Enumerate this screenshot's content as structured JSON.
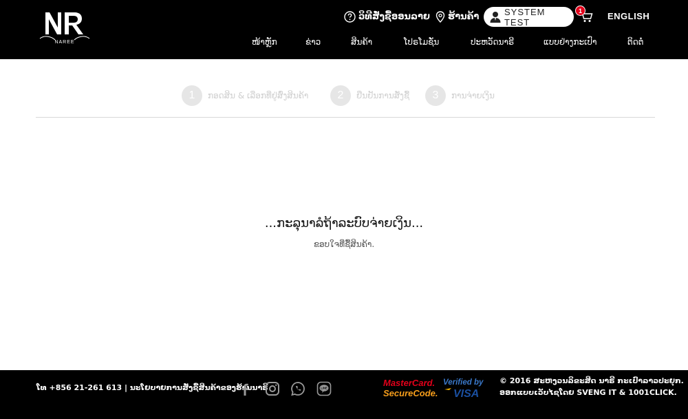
{
  "header": {
    "logo_text": "NAREE",
    "howto_label": "ວິທີສັ່ງຊື້ອອນລາຍ",
    "store_label": "ຮ້ານຄ້າ",
    "user_name": "SYSTEM TEST",
    "cart_count": "1",
    "language": "ENGLISH"
  },
  "nav": {
    "items": [
      "ໜ້າຫຼັກ",
      "ຂ່າວ",
      "ສິນຄ້າ",
      "ໂປຣໂມຊັ່ນ",
      "ປະຫວັດນາຣີ",
      "ແບບຢ່າງກະເປົາ",
      "ຕິດຕໍ່"
    ]
  },
  "steps": [
    {
      "num": "1",
      "label": "ກອດສິນ & ເລືອກທີ່ຢູ່ສົ່ງສິນຄ້າ"
    },
    {
      "num": "2",
      "label": "ຢືນຢັນການສັ່ງຊື້"
    },
    {
      "num": "3",
      "label": "ການຈ່າຍເງິນ"
    }
  ],
  "main": {
    "title": "...ກະລຸນາລໍຖ້າລະບົບຈ່າຍເງິນ...",
    "subtitle": "ຂອບໃຈທີ່ຊື້ສິນຄ້າ."
  },
  "footer": {
    "contact": "ໂທ +856 21-261 613  |   ນະໂຍບາຍການສັ່ງຊື້ສິນຄ້າຂອງຮ້ານນາຣີ",
    "mastercard_line1": "MasterCard.",
    "mastercard_line2": "SecureCode.",
    "visa_line1": "Verified by",
    "visa_line2": "VISA",
    "copyright": "© 2016 ສະຫງວນລິຂະສິດ ນາຣີ ກະເປົາລາວປະຍຸກ.",
    "credit": "ອອກແບບເວັບໄຊໂດຍ SVENG IT & 1001CLICK."
  },
  "colors": {
    "header_bg": "#000000",
    "badge": "#e2001a",
    "step_circle": "#e6e6e6",
    "step_text": "#cfcfcf",
    "mastercard_red": "#e2001a",
    "mastercard_orange": "#f79e1b",
    "visa_blue": "#1a4fa0"
  }
}
